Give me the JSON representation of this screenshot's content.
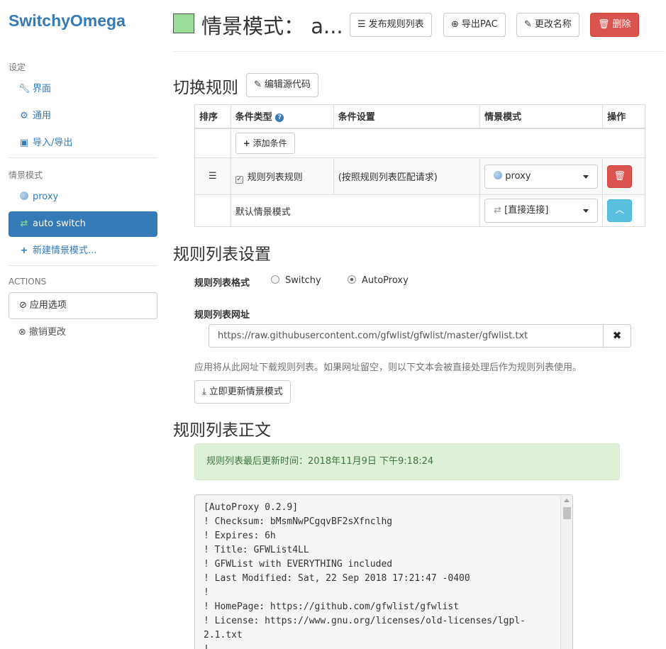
{
  "brand": "SwitchyOmega",
  "sidebar": {
    "settings_header": "设定",
    "settings_items": [
      {
        "label": "界面",
        "icon": "wrench-icon"
      },
      {
        "label": "通用",
        "icon": "gear-icon"
      },
      {
        "label": "导入/导出",
        "icon": "floppy-icon"
      }
    ],
    "profiles_header": "情景模式",
    "profiles": [
      {
        "label": "proxy",
        "icon": "globe-icon"
      },
      {
        "label": "auto switch",
        "icon": "retweet-icon",
        "active": true
      },
      {
        "label": "新建情景模式...",
        "icon": "plus-icon"
      }
    ],
    "actions_header": "ACTIONS",
    "apply_label": "应用选项",
    "discard_label": "撤销更改"
  },
  "header": {
    "swatch_color": "#99dd99",
    "title": "情景模式： a...",
    "publish_label": "发布规则列表",
    "export_label": "导出PAC",
    "rename_label": "更改名称",
    "delete_label": "删除"
  },
  "switch_rules": {
    "title": "切换规则",
    "edit_source_label": "编辑源代码",
    "columns": [
      "排序",
      "条件类型",
      "条件设置",
      "情景模式",
      "操作"
    ],
    "add_condition_label": "添加条件",
    "rule_row": {
      "condition_type": "规则列表规则",
      "condition_setting": "(按照规则列表匹配请求)",
      "profile": "proxy"
    },
    "default_row": {
      "label": "默认情景模式",
      "profile": "[直接连接]"
    }
  },
  "rule_list_settings": {
    "title": "规则列表设置",
    "format_label": "规则列表格式",
    "format_options": [
      "Switchy",
      "AutoProxy"
    ],
    "format_selected": "AutoProxy",
    "url_label": "规则列表网址",
    "url_value": "https://raw.githubusercontent.com/gfwlist/gfwlist/master/gfwlist.txt",
    "help_text": "应用将从此网址下载规则列表。如果网址留空，则以下文本会被直接处理后作为规则列表使用。",
    "update_label": "立即更新情景模式"
  },
  "rule_list_text": {
    "title": "规则列表正文",
    "last_updated": "规则列表最后更新时间：2018年11月9日 下午9:18:24",
    "lines": [
      "[AutoProxy 0.2.9]",
      "! Checksum: bMsmNwPCgqvBF2sXfnclhg",
      "! Expires: 6h",
      "! Title: GFWList4LL",
      "! GFWList with EVERYTHING included",
      "! Last Modified: Sat, 22 Sep 2018 17:21:47 -0400",
      "!",
      "! HomePage: https://github.com/gfwlist/gfwlist",
      "! License: https://www.gnu.org/licenses/old-licenses/lgpl-",
      "2.1.txt",
      "!"
    ]
  }
}
